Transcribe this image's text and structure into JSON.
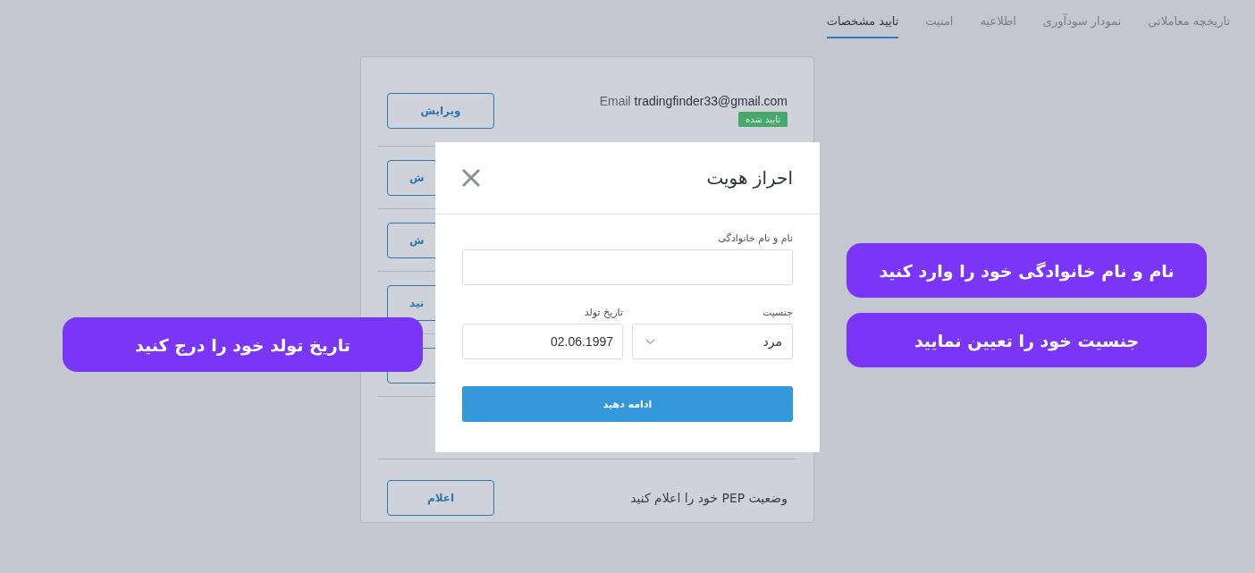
{
  "tabs": [
    {
      "label": "تاریخچه معاملاتی",
      "selected": false
    },
    {
      "label": "نمودار سودآوری",
      "selected": false
    },
    {
      "label": "اطلاعیه",
      "selected": false
    },
    {
      "label": "امنیت",
      "selected": false
    },
    {
      "label": "تایید مشخصات",
      "selected": true
    }
  ],
  "card": {
    "email_row": {
      "label": "Email",
      "value": "tradingfinder33@gmail.com",
      "badge": "تایید شده",
      "button": "ویرایش"
    },
    "covered_rows": [
      {
        "button": "ش"
      },
      {
        "button": "ش"
      },
      {
        "button": "نید"
      }
    ],
    "pep_row": {
      "text": "وضعیت PEP خود را اعلام کنید",
      "button": "اعلام"
    }
  },
  "modal": {
    "title": "احراز هویت",
    "name_field": {
      "label": "نام و نام خانوادگی"
    },
    "gender_field": {
      "label": "جنسیت",
      "value": "مرد"
    },
    "birth_field": {
      "label": "تاریخ تولد",
      "value": "02.06.1997"
    },
    "submit": "ادامه دهید"
  },
  "callouts_right": [
    {
      "text": "نام و نام خانوادگی خود را وارد کنید"
    },
    {
      "text": "جنسیت خود را تعیین نمایید"
    }
  ],
  "callout_left": {
    "text": "تاریخ تولد خود را درج کنید"
  }
}
